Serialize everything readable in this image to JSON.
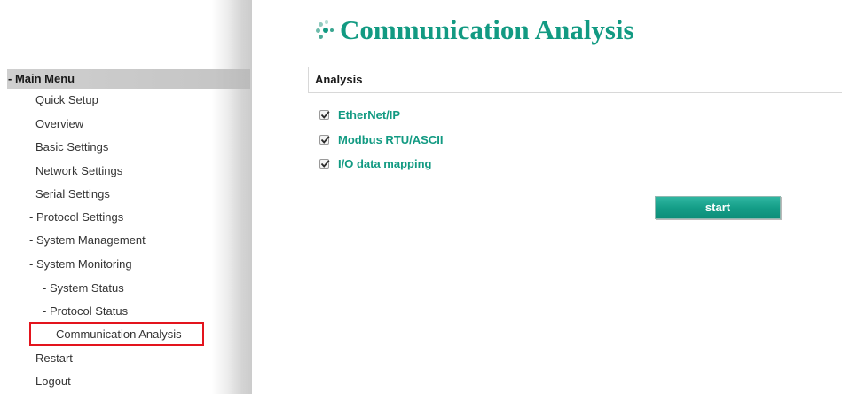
{
  "page": {
    "title": "Communication Analysis"
  },
  "sidebar": {
    "header": "- Main Menu",
    "items": [
      {
        "label": "Quick Setup"
      },
      {
        "label": "Overview"
      },
      {
        "label": "Basic Settings"
      },
      {
        "label": "Network Settings"
      },
      {
        "label": "Serial Settings"
      },
      {
        "label": "- Protocol Settings"
      },
      {
        "label": "- System Management"
      },
      {
        "label": "- System Monitoring"
      },
      {
        "label": "- System Status"
      },
      {
        "label": "- Protocol Status"
      },
      {
        "label": "Communication Analysis",
        "selected": true
      },
      {
        "label": "Restart"
      },
      {
        "label": "Logout"
      }
    ]
  },
  "analysis": {
    "section_title": "Analysis",
    "options": [
      {
        "label": "EtherNet/IP",
        "checked": true
      },
      {
        "label": "Modbus RTU/ASCII",
        "checked": true
      },
      {
        "label": "I/O data mapping",
        "checked": true
      }
    ],
    "start_label": "start"
  },
  "colors": {
    "accent": "#129a82",
    "button": "#159e88",
    "highlight_border": "#e3141d",
    "menu_header_bg": "#c8c8c8"
  }
}
